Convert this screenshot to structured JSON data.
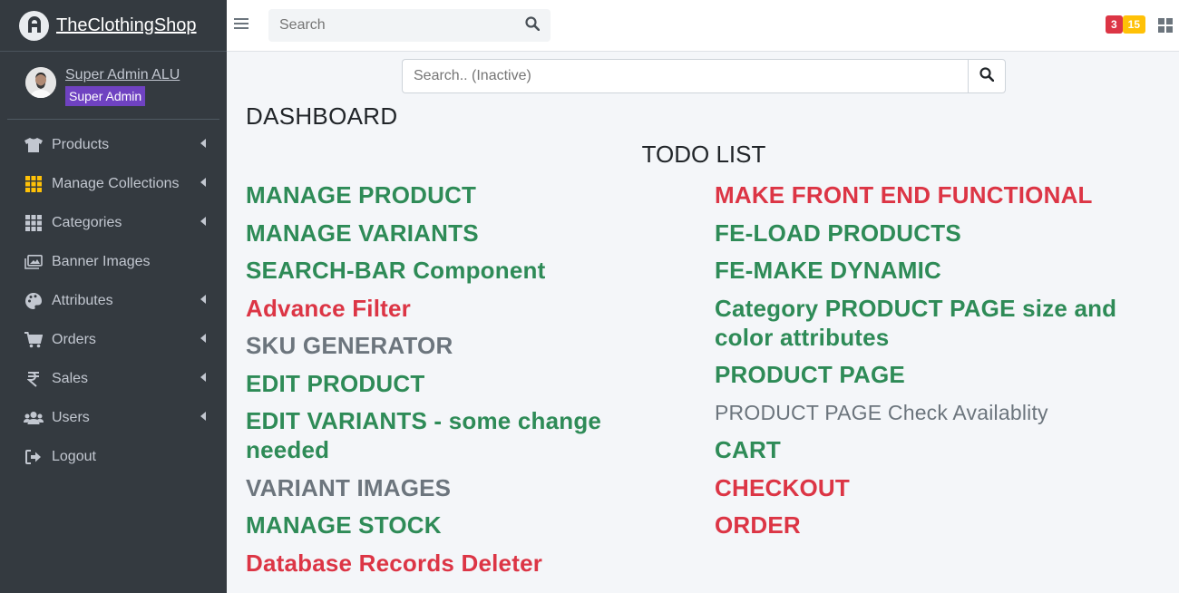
{
  "brand": {
    "name": "TheClothingShop"
  },
  "user": {
    "name": "Super Admin ALU",
    "role": "Super Admin"
  },
  "nav": [
    {
      "label": "Products",
      "icon": "tshirt-icon",
      "has_arrow": true
    },
    {
      "label": "Manage Collections",
      "icon": "grid-icon",
      "has_arrow": true
    },
    {
      "label": "Categories",
      "icon": "grid-icon",
      "has_arrow": true
    },
    {
      "label": "Banner Images",
      "icon": "images-icon",
      "has_arrow": false
    },
    {
      "label": "Attributes",
      "icon": "palette-icon",
      "has_arrow": true
    },
    {
      "label": "Orders",
      "icon": "cart-icon",
      "has_arrow": true
    },
    {
      "label": "Sales",
      "icon": "rupee-icon",
      "has_arrow": true
    },
    {
      "label": "Users",
      "icon": "users-icon",
      "has_arrow": true
    },
    {
      "label": "Logout",
      "icon": "logout-icon",
      "has_arrow": false
    }
  ],
  "topbar": {
    "search_placeholder": "Search",
    "badge_red": "3",
    "badge_yellow": "15"
  },
  "main": {
    "search_placeholder": "Search.. (Inactive)",
    "title": "DASHBOARD",
    "todo_title": "TODO LIST"
  },
  "todo_left": [
    {
      "text": "MANAGE PRODUCT",
      "status": "green"
    },
    {
      "text": "MANAGE VARIANTS",
      "status": "green"
    },
    {
      "text": "SEARCH-BAR Component",
      "status": "green"
    },
    {
      "text": "Advance Filter",
      "status": "red"
    },
    {
      "text": "SKU GENERATOR",
      "status": "gray"
    },
    {
      "text": "EDIT PRODUCT",
      "status": "green"
    },
    {
      "text": "EDIT VARIANTS - some change needed",
      "status": "green"
    },
    {
      "text": "VARIANT IMAGES",
      "status": "gray"
    },
    {
      "text": "MANAGE STOCK",
      "status": "green"
    },
    {
      "text": "Database Records Deleter",
      "status": "red"
    }
  ],
  "todo_right": [
    {
      "text": "MAKE FRONT END FUNCTIONAL",
      "status": "red"
    },
    {
      "text": "FE-LOAD PRODUCTS",
      "status": "green"
    },
    {
      "text": "FE-MAKE DYNAMIC",
      "status": "green"
    },
    {
      "text": "Category PRODUCT PAGE size and color attributes",
      "status": "green"
    },
    {
      "text": "PRODUCT PAGE",
      "status": "green"
    },
    {
      "text": "PRODUCT PAGE Check Availablity",
      "status": "gray",
      "small": true
    },
    {
      "text": "CART",
      "status": "green"
    },
    {
      "text": "CHECKOUT",
      "status": "red"
    },
    {
      "text": "ORDER",
      "status": "red"
    }
  ],
  "colors": {
    "green": "#2e8b57",
    "red": "#dc3545",
    "gray": "#6c757d",
    "sidebar": "#343a40",
    "role_badge": "#6f42c1"
  }
}
